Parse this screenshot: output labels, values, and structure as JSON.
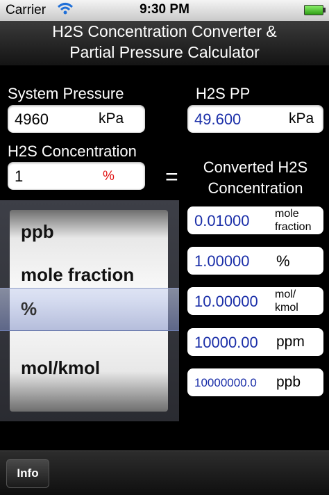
{
  "status": {
    "carrier": "Carrier",
    "time": "9:30 PM"
  },
  "title": {
    "line1": "H2S Concentration Converter &",
    "line2": "Partial Pressure Calculator"
  },
  "system_pressure": {
    "label": "System Pressure",
    "value": "4960",
    "unit": "kPa"
  },
  "h2s_pp": {
    "label": "H2S PP",
    "value": "49.600",
    "unit": "kPa"
  },
  "h2s_concentration": {
    "label": "H2S Concentration",
    "value": "1",
    "unit": "%"
  },
  "equals": "=",
  "converted": {
    "label1": "Converted H2S",
    "label2": "Concentration"
  },
  "picker": {
    "items": [
      "ppb",
      "mole fraction",
      "%",
      "mol/kmol"
    ],
    "selected": "%"
  },
  "results": [
    {
      "value": "0.01000",
      "unit1": "mole",
      "unit2": "fraction"
    },
    {
      "value": "1.00000",
      "unit1": "%"
    },
    {
      "value": "10.00000",
      "unit1": "mol/",
      "unit2": "kmol"
    },
    {
      "value": "10000.00",
      "unit1": "ppm"
    },
    {
      "value": "10000000.0",
      "unit1": "ppb"
    }
  ],
  "toolbar": {
    "info_label": "Info"
  },
  "colors": {
    "accent_blue": "#1a2ea8",
    "unit_red": "#e01010"
  }
}
